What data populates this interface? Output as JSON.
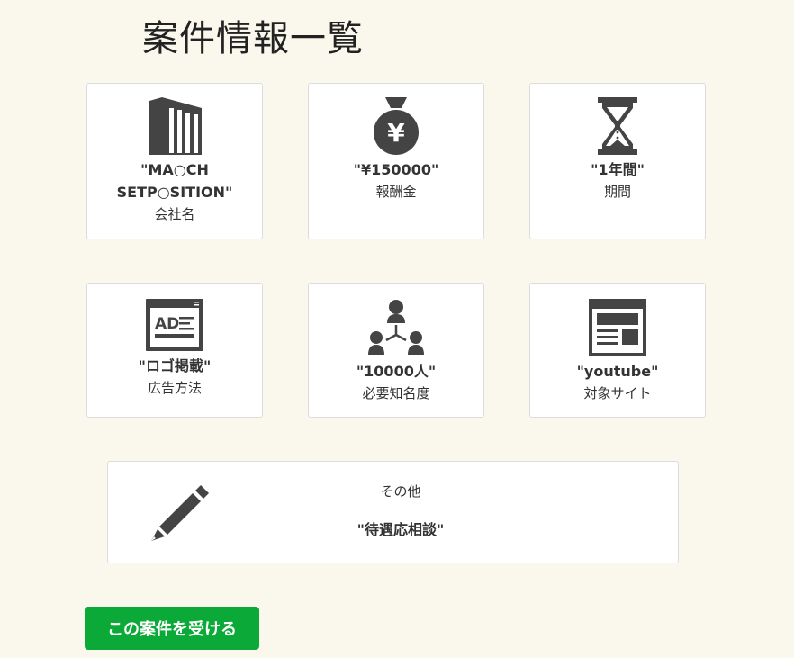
{
  "page": {
    "title": "案件情報一覧"
  },
  "cards": [
    {
      "icon": "building-icon",
      "value": "\"MA○CH SETP○SITION\"",
      "label": "会社名"
    },
    {
      "icon": "money-bag-icon",
      "value": "\"¥150000\"",
      "label": "報酬金"
    },
    {
      "icon": "hourglass-icon",
      "value": "\"1年間\"",
      "label": "期間"
    },
    {
      "icon": "ad-icon",
      "value": "\"ロゴ掲載\"",
      "label": "広告方法"
    },
    {
      "icon": "people-network-icon",
      "value": "\"10000人\"",
      "label": "必要知名度"
    },
    {
      "icon": "website-icon",
      "value": "\"youtube\"",
      "label": "対象サイト"
    }
  ],
  "other": {
    "icon": "pencil-icon",
    "label": "その他",
    "value": "\"待遇応相談\""
  },
  "actions": {
    "accept_label": "この案件を受ける",
    "accent_color": "#0aa938"
  },
  "colors": {
    "background": "#faf8ec",
    "icon": "#444444"
  }
}
